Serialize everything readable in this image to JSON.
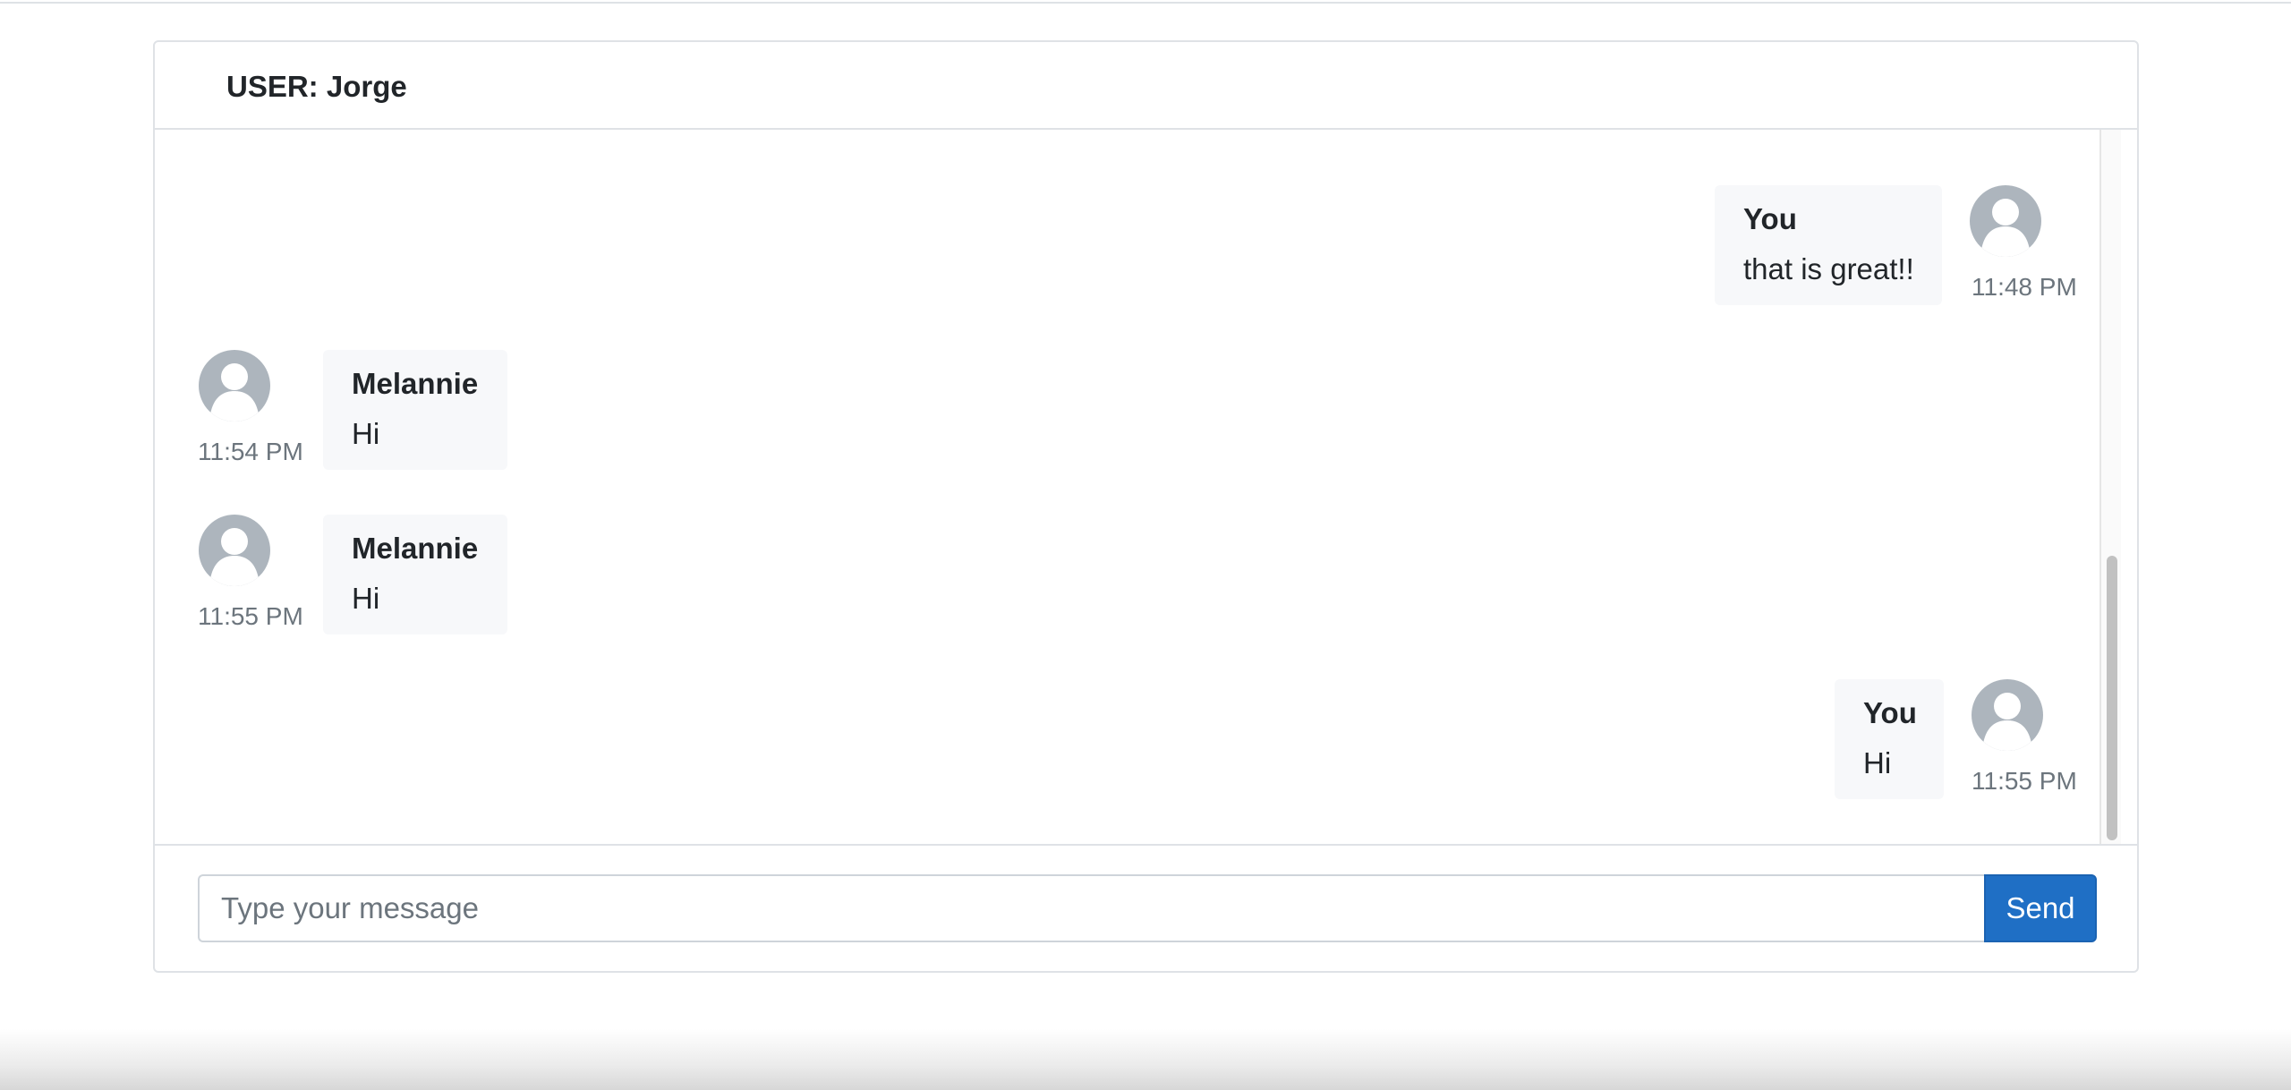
{
  "header": {
    "title": "USER: Jorge"
  },
  "messages": [
    {
      "sender": "You",
      "text": "that is great!!",
      "time": "11:48 PM",
      "side": "right"
    },
    {
      "sender": "Melannie",
      "text": "Hi",
      "time": "11:54 PM",
      "side": "left"
    },
    {
      "sender": "Melannie",
      "text": "Hi",
      "time": "11:55 PM",
      "side": "left"
    },
    {
      "sender": "You",
      "text": "Hi",
      "time": "11:55 PM",
      "side": "right"
    }
  ],
  "composer": {
    "placeholder": "Type your message",
    "value": "",
    "send_label": "Send"
  },
  "colors": {
    "accent": "#1f6fc5",
    "bubble": "#f7f8fa",
    "avatar": "#adb5bd",
    "muted": "#6c757d"
  },
  "icons": {
    "avatar": "user-avatar-icon"
  }
}
